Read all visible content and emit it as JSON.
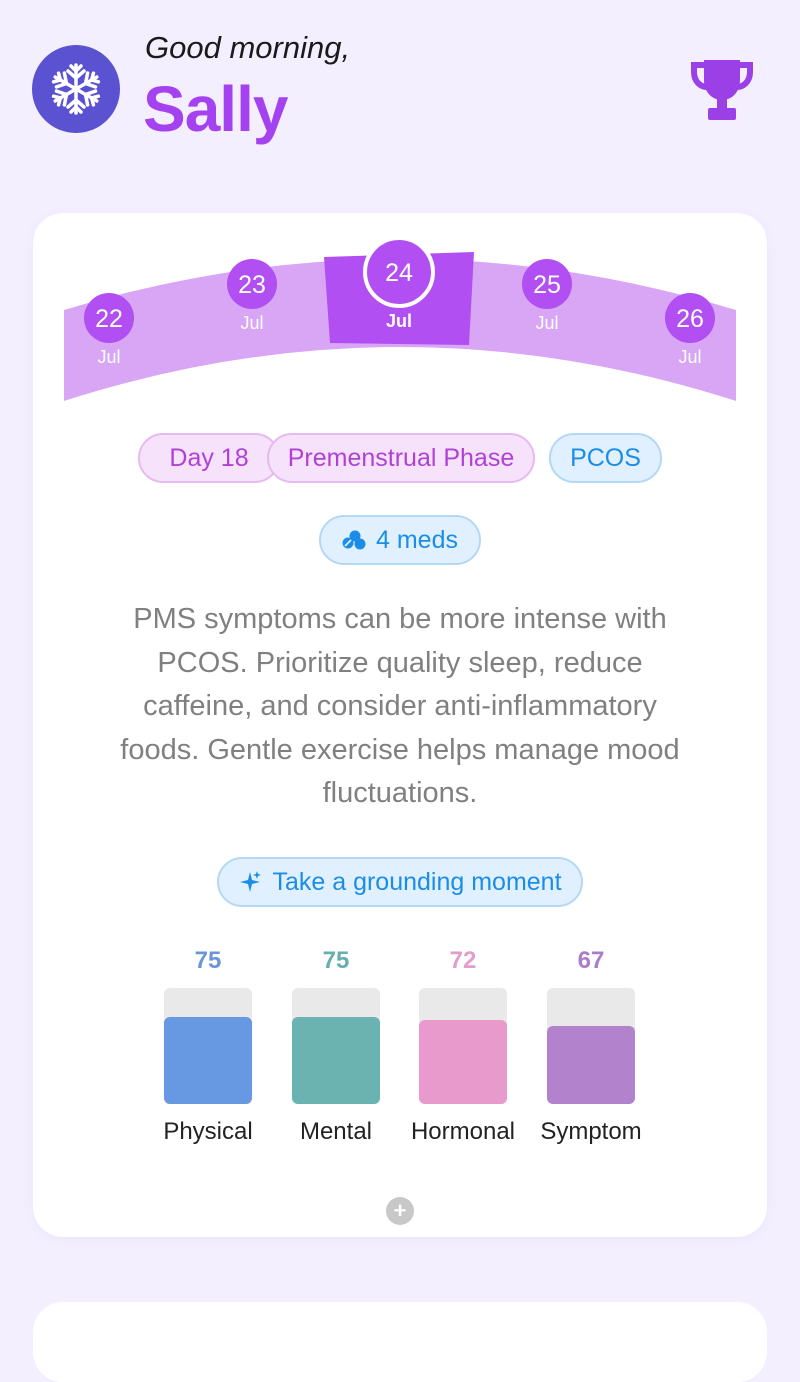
{
  "header": {
    "greeting": "Good morning,",
    "user_name": "Sally",
    "avatar_icon": "snowflake-icon",
    "achievements_icon": "trophy-icon"
  },
  "calendar": {
    "days": [
      {
        "day": "22",
        "month": "Jul",
        "selected": false
      },
      {
        "day": "23",
        "month": "Jul",
        "selected": false
      },
      {
        "day": "24",
        "month": "Jul",
        "selected": true
      },
      {
        "day": "25",
        "month": "Jul",
        "selected": false
      },
      {
        "day": "26",
        "month": "Jul",
        "selected": false
      }
    ]
  },
  "tags": {
    "cycle_day": "Day 18",
    "phase": "Premenstrual Phase",
    "condition": "PCOS"
  },
  "meds": {
    "label": "4 meds",
    "icon": "pills-icon"
  },
  "advice": "PMS symptoms can be more intense with PCOS. Prioritize quality sleep, reduce caffeine, and consider anti-inflammatory foods. Gentle exercise helps manage mood fluctuations.",
  "grounding": {
    "label": "Take a grounding moment",
    "icon": "sparkle-icon"
  },
  "scores": [
    {
      "label": "Physical",
      "value": 75,
      "color": "#6799e3",
      "text_color": "#6a95d9"
    },
    {
      "label": "Mental",
      "value": 75,
      "color": "#6ab3b0",
      "text_color": "#66aeb0"
    },
    {
      "label": "Hormonal",
      "value": 72,
      "color": "#e79acb",
      "text_color": "#e49ccc"
    },
    {
      "label": "Symptom",
      "value": 67,
      "color": "#b282cc",
      "text_color": "#a97dcb"
    }
  ],
  "colors": {
    "accent": "#a542f0",
    "background": "#f4efff"
  }
}
